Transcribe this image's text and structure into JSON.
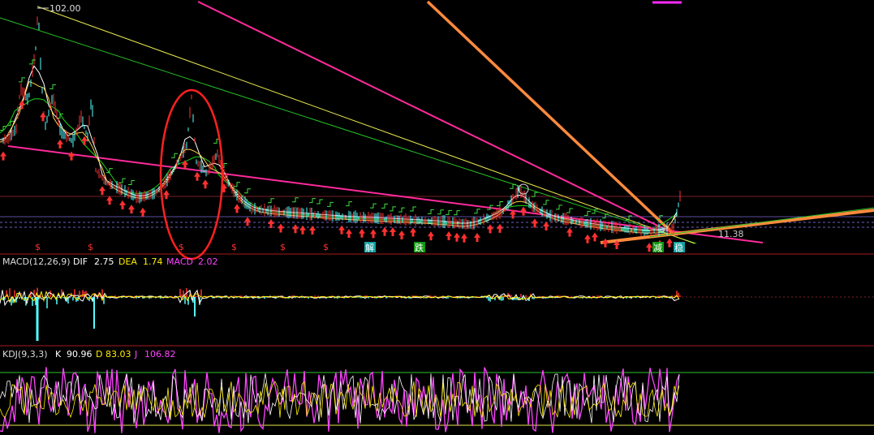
{
  "chart_data": [
    {
      "panel": "price",
      "type": "candlestick",
      "ylim": [
        0,
        102
      ],
      "high_label": "102.00",
      "last_label": "11.38",
      "marker_text": [
        "$",
        "$",
        "$",
        "$",
        "$",
        "$",
        "解",
        "跌",
        "减",
        "稳"
      ],
      "colors": {
        "up": "#ff3030",
        "down": "#54ffff",
        "ma_green": "#19d619",
        "ma_white": "#ffffff",
        "ma_yellow": "#ffd24a",
        "trend_magenta": "#ff2a9c",
        "trend_yellow": "#e8e84f",
        "trend_green": "#24c024",
        "trend_orange": "#ff8a3d",
        "circle": "#ff2020"
      }
    },
    {
      "panel": "macd",
      "type": "line",
      "title": "MACD(12,26,9)",
      "series": [
        {
          "name": "DIF",
          "value": "2.75",
          "color": "#ffffff"
        },
        {
          "name": "DEA",
          "value": "1.74",
          "color": "#ffee00"
        },
        {
          "name": "MACD",
          "value": "2.02",
          "color": "#ff44ff"
        }
      ]
    },
    {
      "panel": "kdj",
      "type": "line",
      "title": "KDJ(9,3,3)",
      "series": [
        {
          "name": "K",
          "value": "90.96",
          "color": "#ffffff"
        },
        {
          "name": "D",
          "value": "83.03",
          "color": "#ffee00"
        },
        {
          "name": "J",
          "value": "106.82",
          "color": "#ff44ff"
        }
      ]
    }
  ]
}
